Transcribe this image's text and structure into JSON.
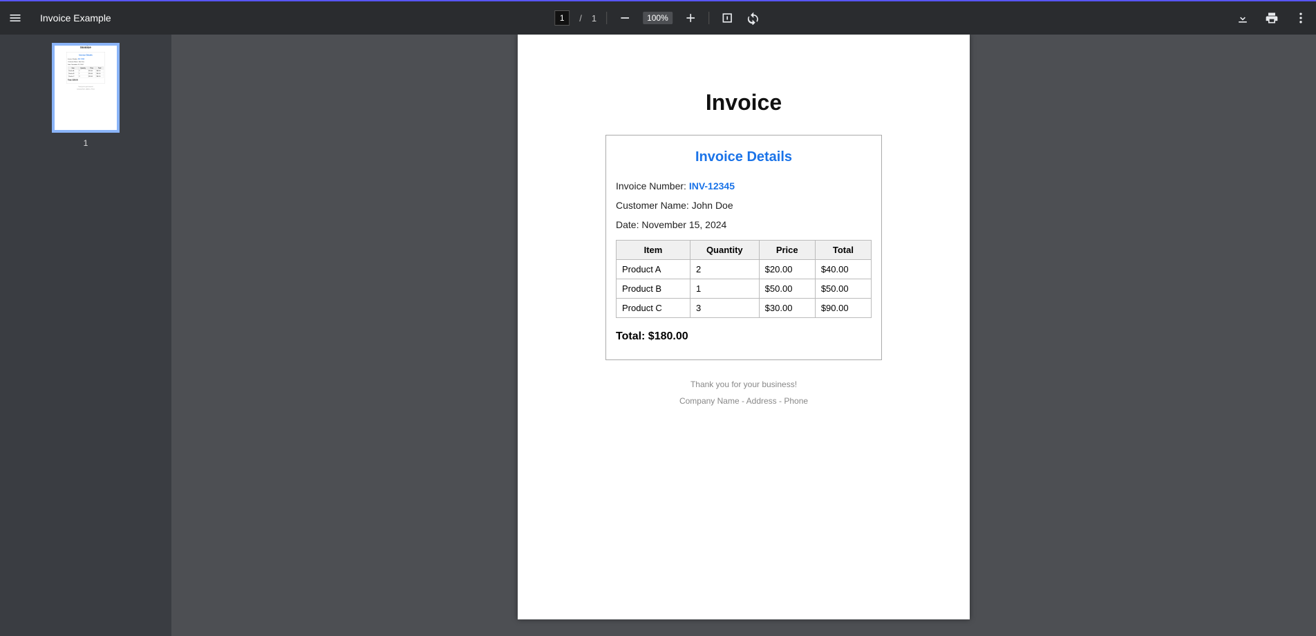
{
  "viewer": {
    "doc_title": "Invoice Example",
    "page_input": "1",
    "page_sep": "/",
    "page_total": "1",
    "zoom": "100%",
    "thumb_label": "1"
  },
  "doc": {
    "heading": "Invoice",
    "details_title": "Invoice Details",
    "inv_num_label": "Invoice Number: ",
    "inv_num_value": "INV-12345",
    "customer_label": "Customer Name: ",
    "customer_value": "John Doe",
    "date_label": "Date: ",
    "date_value": "November 15, 2024",
    "table": {
      "headers": {
        "item": "Item",
        "qty": "Quantity",
        "price": "Price",
        "total": "Total"
      },
      "rows": [
        {
          "item": "Product A",
          "qty": "2",
          "price": "$20.00",
          "total": "$40.00"
        },
        {
          "item": "Product B",
          "qty": "1",
          "price": "$50.00",
          "total": "$50.00"
        },
        {
          "item": "Product C",
          "qty": "3",
          "price": "$30.00",
          "total": "$90.00"
        }
      ]
    },
    "total_line": "Total: $180.00",
    "footer1": "Thank you for your business!",
    "footer2": "Company Name - Address - Phone"
  }
}
